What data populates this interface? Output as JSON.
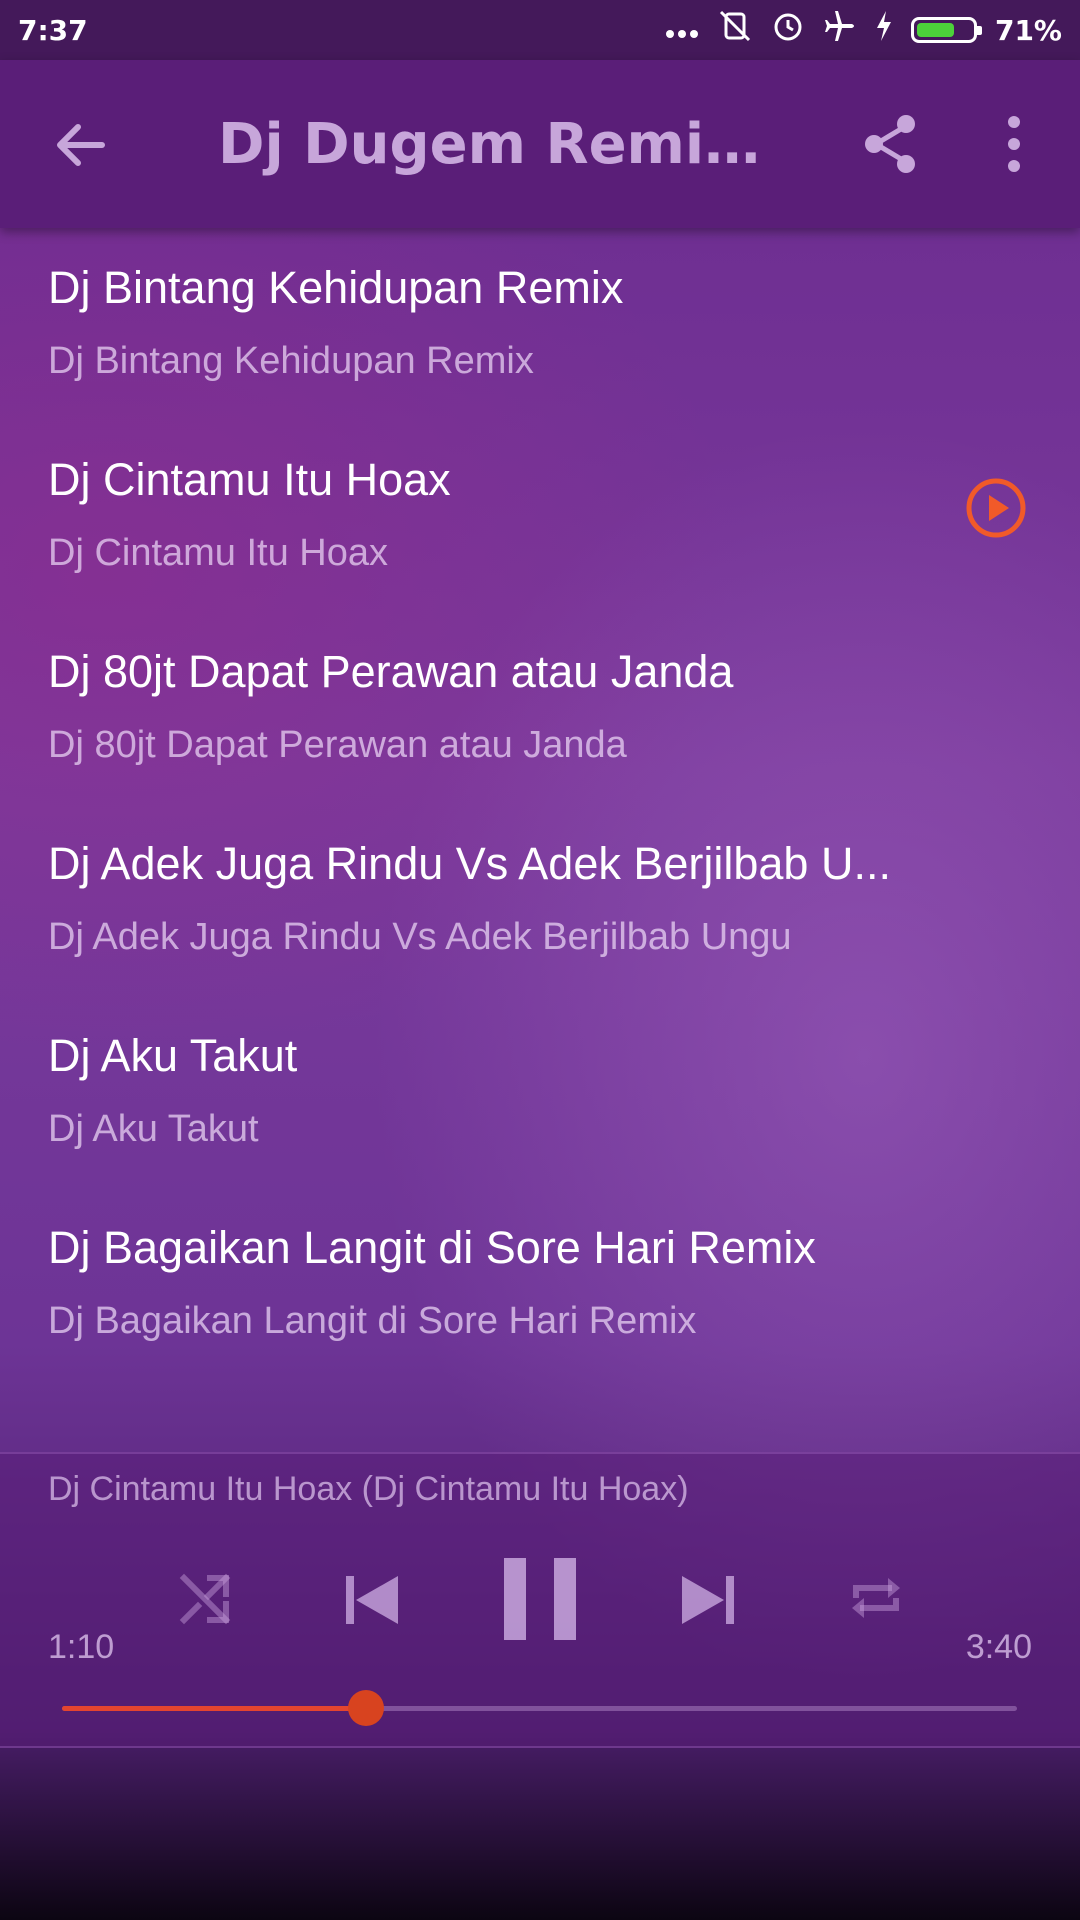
{
  "status_bar": {
    "time": "7:37",
    "battery_text": "71%",
    "battery_level": 0.71,
    "icons": [
      "more-dots-icon",
      "vibrate-off-icon",
      "alarm-icon",
      "airplane-icon",
      "charging-icon",
      "battery-icon"
    ]
  },
  "app_bar": {
    "title": "Dj Dugem Remix (V...",
    "back_icon": "arrow-back-icon",
    "share_icon": "share-icon",
    "menu_icon": "more-vert-icon"
  },
  "tracks": [
    {
      "title": "Dj Bintang Kehidupan Remix",
      "subtitle": "Dj Bintang Kehidupan Remix",
      "playing": false
    },
    {
      "title": "Dj Cintamu Itu Hoax",
      "subtitle": "Dj Cintamu Itu Hoax",
      "playing": true
    },
    {
      "title": "Dj 80jt Dapat Perawan atau Janda",
      "subtitle": "Dj 80jt Dapat Perawan atau Janda",
      "playing": false
    },
    {
      "title": "Dj Adek Juga Rindu Vs Adek Berjilbab U...",
      "subtitle": "Dj Adek Juga Rindu Vs Adek Berjilbab Ungu",
      "playing": false
    },
    {
      "title": "Dj Aku Takut",
      "subtitle": "Dj Aku Takut",
      "playing": false
    },
    {
      "title": "Dj Bagaikan Langit di Sore Hari Remix",
      "subtitle": "Dj Bagaikan Langit di Sore Hari Remix",
      "playing": false
    }
  ],
  "player": {
    "now_playing": "Dj Cintamu Itu Hoax (Dj Cintamu Itu Hoax)",
    "elapsed": "1:10",
    "duration": "3:40",
    "progress": 0.318,
    "controls": [
      "shuffle-icon",
      "skip-previous-icon",
      "pause-icon",
      "skip-next-icon",
      "repeat-icon"
    ],
    "accent_color": "#e4452f",
    "play_icon_color": "#f15a29"
  }
}
